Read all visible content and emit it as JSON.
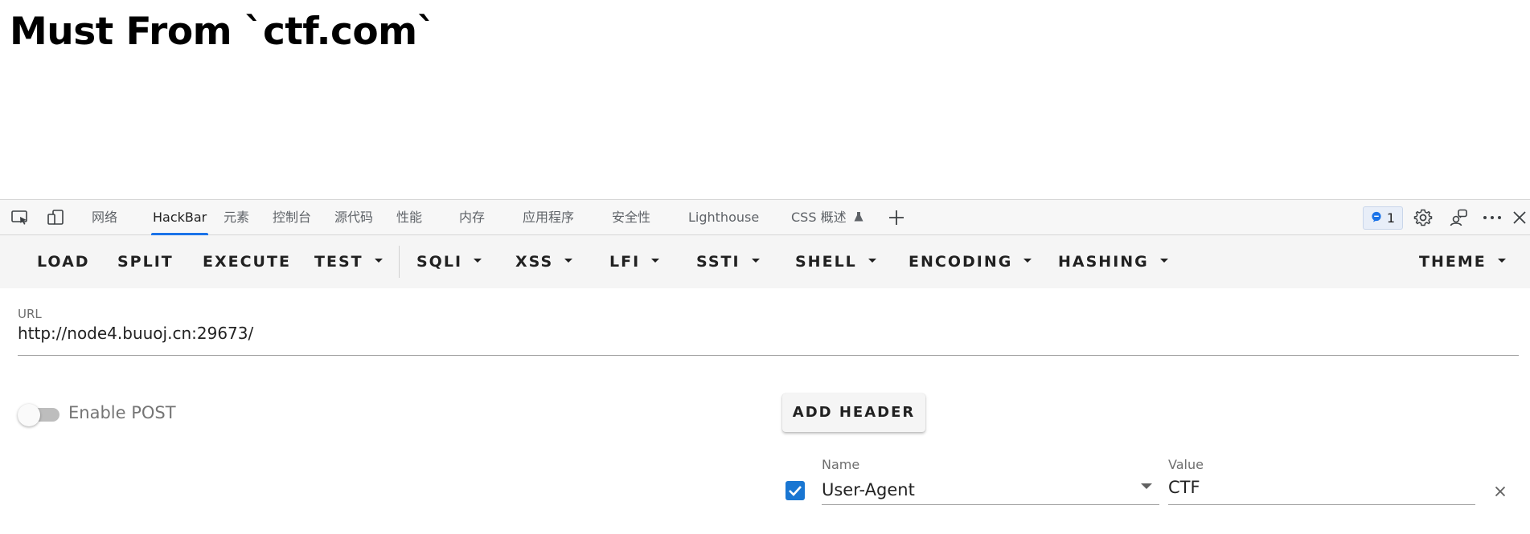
{
  "page": {
    "heading": "Must From `ctf.com`"
  },
  "devtools": {
    "tabs": [
      {
        "label": "网络"
      },
      {
        "label": "HackBar"
      },
      {
        "label": "元素"
      },
      {
        "label": "控制台"
      },
      {
        "label": "源代码"
      },
      {
        "label": "性能"
      },
      {
        "label": "内存"
      },
      {
        "label": "应用程序"
      },
      {
        "label": "安全性"
      },
      {
        "label": "Lighthouse"
      },
      {
        "label": "CSS 概述"
      }
    ],
    "active_tab": "HackBar",
    "issues_count": "1",
    "colors": {
      "active_underline": "#1a73e8",
      "badge_bg": "#e8eef8"
    }
  },
  "hackbar": {
    "toolbar": {
      "load": "LOAD",
      "split": "SPLIT",
      "execute": "EXECUTE",
      "test": "TEST",
      "sqli": "SQLI",
      "xss": "XSS",
      "lfi": "LFI",
      "ssti": "SSTI",
      "shell": "SHELL",
      "encoding": "ENCODING",
      "hashing": "HASHING",
      "theme": "THEME"
    },
    "url": {
      "label": "URL",
      "value": "http://node4.buuoj.cn:29673/"
    },
    "post": {
      "label": "Enable POST",
      "enabled": false
    },
    "add_header_label": "ADD HEADER",
    "headers": [
      {
        "enabled": true,
        "name_label": "Name",
        "name": "User-Agent",
        "value_label": "Value",
        "value": "CTF"
      }
    ],
    "colors": {
      "checkbox": "#1976d2",
      "toolbar_bg": "#f5f5f5"
    }
  }
}
